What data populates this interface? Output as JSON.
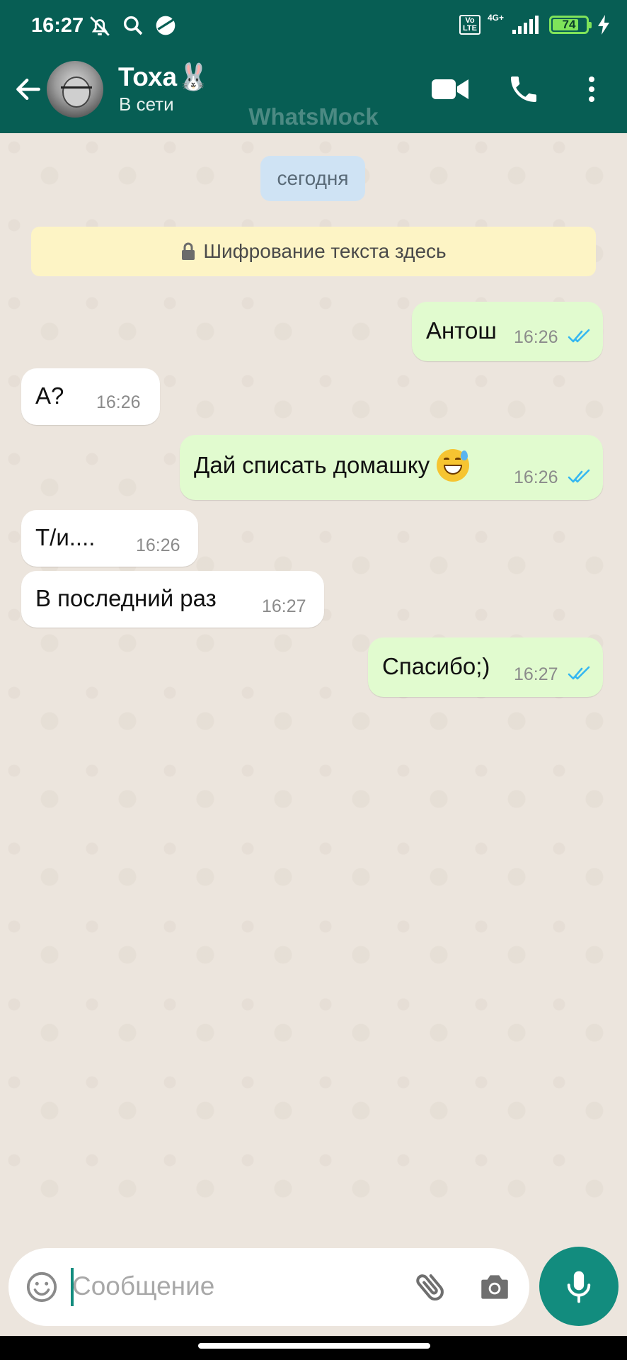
{
  "status_bar": {
    "time": "16:27",
    "network_label": "4G+",
    "volte_label": "Vo LTE",
    "battery_percent": "74",
    "icons": [
      "muted-bell-icon",
      "search-icon",
      "circle-app-icon",
      "signal-icon",
      "battery-icon",
      "charging-bolt-icon"
    ]
  },
  "header": {
    "contact_name": "Тоха🐰",
    "contact_status": "В сети",
    "watermark": "WhatsMock",
    "icons": [
      "back-arrow-icon",
      "video-call-icon",
      "phone-call-icon",
      "more-menu-icon"
    ]
  },
  "chat": {
    "date_label": "сегодня",
    "encryption_notice": "Шифрование текста здесь",
    "messages": [
      {
        "direction": "out",
        "text": "Антош",
        "time": "16:26",
        "status": "read"
      },
      {
        "direction": "in",
        "text": "А?",
        "time": "16:26"
      },
      {
        "direction": "out",
        "text": "Дай списать домашку",
        "emoji": "grinning-sweat-emoji",
        "time": "16:26",
        "status": "read"
      },
      {
        "direction": "in",
        "text": "Т/и....",
        "time": "16:26"
      },
      {
        "direction": "in",
        "text": "В последний раз",
        "time": "16:27"
      },
      {
        "direction": "out",
        "text": "Спасибо;)",
        "time": "16:27",
        "status": "read"
      }
    ]
  },
  "input": {
    "placeholder": "Сообщение",
    "value": "",
    "icons": [
      "emoji-icon",
      "attach-icon",
      "camera-icon",
      "mic-icon"
    ]
  },
  "colors": {
    "header": "#075e54",
    "accent": "#128c7e",
    "outgoing_bubble": "#e1fbcf",
    "incoming_bubble": "#ffffff",
    "read_ticks": "#34b7f1",
    "chat_background": "#ece5dd"
  }
}
